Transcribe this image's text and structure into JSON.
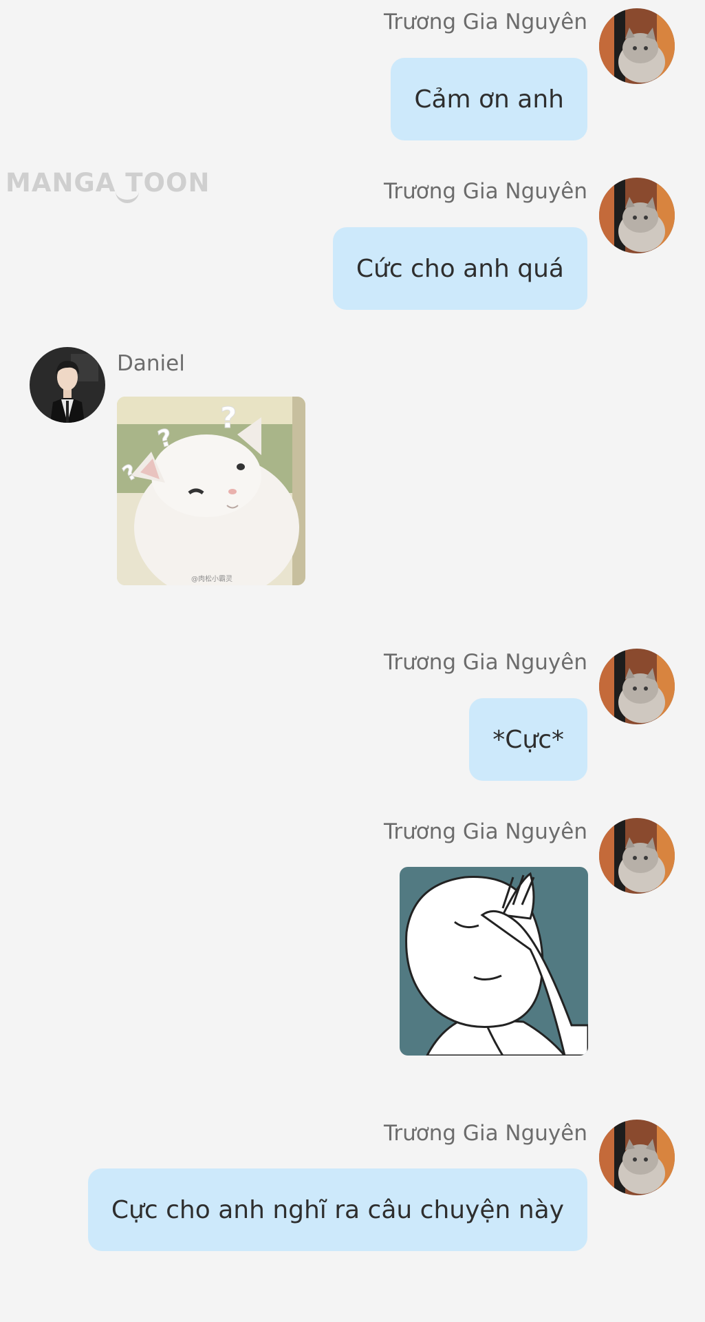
{
  "watermark": "MANGA TOON",
  "messages": [
    {
      "sender": "Trương Gia Nguyên",
      "text": "Cảm ơn anh"
    },
    {
      "sender": "Trương Gia Nguyên",
      "text": "Cức cho anh quá"
    },
    {
      "sender": "Daniel",
      "sticker": "confused-cat-sticker",
      "sticker_caption": "@肉松小霸灵"
    },
    {
      "sender": "Trương Gia Nguyên",
      "text": "*Cực*"
    },
    {
      "sender": "Trương Gia Nguyên",
      "sticker": "facepalm-sticker"
    },
    {
      "sender": "Trương Gia Nguyên",
      "text": "Cực cho anh nghĩ ra câu chuyện này"
    }
  ],
  "colors": {
    "background": "#f4f4f4",
    "bubble": "#cde9fb",
    "name_text": "#6c6c6c",
    "message_text": "#2e2e2e",
    "watermark": "#cfcfcf"
  }
}
